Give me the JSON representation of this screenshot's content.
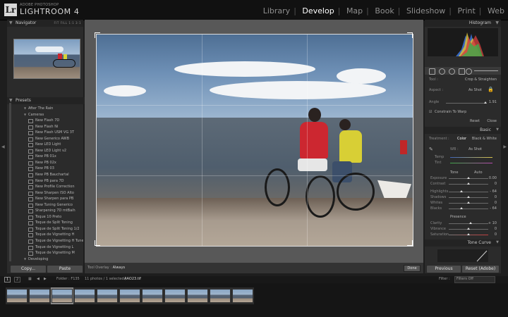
{
  "app": {
    "vendor": "ADOBE PHOTOSHOP",
    "name": "LIGHTROOM 4",
    "logo": "Lr"
  },
  "modules": [
    "Library",
    "Develop",
    "Map",
    "Book",
    "Slideshow",
    "Print",
    "Web"
  ],
  "active_module": "Develop",
  "left": {
    "navigator_title": "Navigator",
    "navigator_options": "FIT  FILL  1:1  3:1",
    "presets_title": "Presets",
    "presets": [
      {
        "label": "After The Rain",
        "type": "folder"
      },
      {
        "label": "Cameras",
        "type": "folder"
      },
      {
        "label": "New Flash 7D",
        "type": "item"
      },
      {
        "label": "New Flash Ni",
        "type": "item"
      },
      {
        "label": "New Flash USM VG 3T",
        "type": "item"
      },
      {
        "label": "New Generico AWB",
        "type": "item"
      },
      {
        "label": "New LED Light",
        "type": "item"
      },
      {
        "label": "New LED Light v2",
        "type": "item"
      },
      {
        "label": "New PB 01x",
        "type": "item"
      },
      {
        "label": "New PB 02x",
        "type": "item"
      },
      {
        "label": "New PB 03",
        "type": "item"
      },
      {
        "label": "New PB Bauchartal",
        "type": "item"
      },
      {
        "label": "New PB para 7D",
        "type": "item"
      },
      {
        "label": "New Profile Correction",
        "type": "item"
      },
      {
        "label": "New Sharpen ISO Alto",
        "type": "item"
      },
      {
        "label": "New Sharpen para PB",
        "type": "item"
      },
      {
        "label": "New Tuning Generico",
        "type": "item"
      },
      {
        "label": "Sharpening 7D mtBaih",
        "type": "item"
      },
      {
        "label": "Toque 10 Preto",
        "type": "item"
      },
      {
        "label": "Toque de Split Toning",
        "type": "item"
      },
      {
        "label": "Toque de Split Toning 1/2",
        "type": "item"
      },
      {
        "label": "Toque de Vignetting H",
        "type": "item"
      },
      {
        "label": "Toque de Vignetting H Tunel",
        "type": "item"
      },
      {
        "label": "Toque de Vignetting L",
        "type": "item"
      },
      {
        "label": "Toque de Vignetting M",
        "type": "item"
      },
      {
        "label": "Developing",
        "type": "folder"
      }
    ],
    "copy_label": "Copy...",
    "paste_label": "Paste"
  },
  "center": {
    "tool_overlay_label": "Tool Overlay :",
    "tool_overlay_value": "Always",
    "done_label": "Done"
  },
  "right": {
    "histogram_title": "Histogram",
    "crop_tool_label": "Tool :",
    "crop_title": "Crop & Straighten",
    "aspect_label": "Aspect :",
    "aspect_value": "As Shot",
    "angle_label": "Angle",
    "angle_value": "1.91",
    "constrain_label": "Constrain To Warp",
    "reset_label": "Reset",
    "close_label": "Close",
    "basic_title": "Basic",
    "treatment_label": "Treatment :",
    "color_label": "Color",
    "bw_label": "Black & White",
    "wb_label": "WB :",
    "wb_value": "As Shot",
    "temp_label": "Temp",
    "tint_label": "Tint",
    "tone_label": "Tone",
    "auto_label": "Auto",
    "exposure_label": "Exposure",
    "exposure_value": "0.00",
    "contrast_label": "Contrast",
    "contrast_value": "0",
    "highlights_label": "Highlights",
    "highlights_value": "- 64",
    "shadows_label": "Shadows",
    "shadows_value": "0",
    "whites_label": "Whites",
    "whites_value": "0",
    "blacks_label": "Blacks",
    "blacks_value": "- 64",
    "presence_label": "Presence",
    "clarity_label": "Clarity",
    "clarity_value": "+ 10",
    "vibrance_label": "Vibrance",
    "vibrance_value": "0",
    "saturation_label": "Saturation",
    "saturation_value": "0",
    "tone_curve_title": "Tone Curve",
    "previous_label": "Previous",
    "reset_adobe_label": "Reset (Adobe)"
  },
  "filmstrip": {
    "page1": "1",
    "page2": "2",
    "folder_label": "Folder : F135",
    "count_label": "11 photos / 1 selected /",
    "filename": "AAO23.tif",
    "filter_label": "Filter :",
    "filter_value": "Filters Off"
  },
  "colors": {
    "accent_active": "#ffffff",
    "panel": "#2b2b2b",
    "background": "#1e1e1e"
  }
}
